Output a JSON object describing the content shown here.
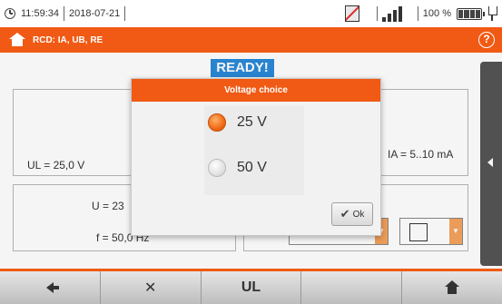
{
  "status": {
    "time": "11:59:34",
    "date": "2018-07-21",
    "battery": "100 %"
  },
  "header": {
    "title": "RCD: IA, UB, RE",
    "help": "?"
  },
  "main": {
    "badge": "READY!",
    "ul_label": "UL = 25,0 V",
    "ia_label": "IA = 5..10 mA",
    "u_value": "U = 23",
    "f_value": "f = 50,0 Hz"
  },
  "dialog": {
    "title": "Voltage choice",
    "options": [
      {
        "label": "25 V",
        "selected": true
      },
      {
        "label": "50 V",
        "selected": false
      }
    ],
    "ok_label": "Ok"
  },
  "footer": {
    "buttons": [
      {
        "icon": "back-icon"
      },
      {
        "icon": "tools-icon"
      },
      {
        "label": "UL"
      },
      {
        "label": ""
      },
      {
        "icon": "home-icon"
      }
    ]
  },
  "colors": {
    "accent": "#f05a14",
    "badge": "#2a8ad8"
  }
}
